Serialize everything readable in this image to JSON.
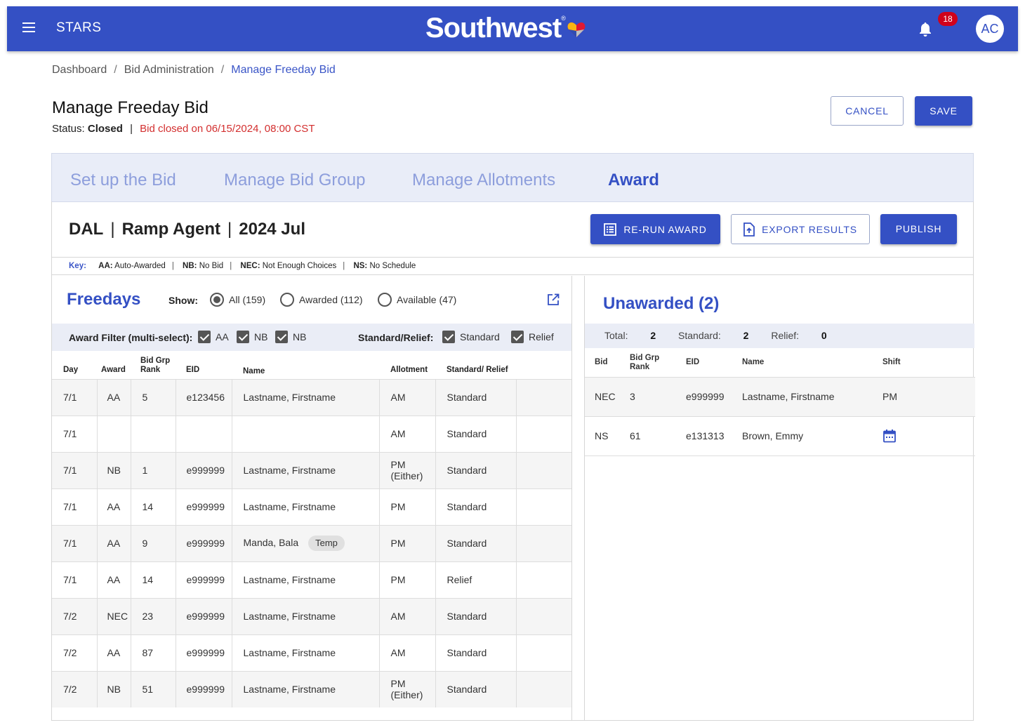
{
  "app": {
    "name": "STARS",
    "brand": "Southwest",
    "notifications": "18",
    "avatar_initials": "AC"
  },
  "breadcrumb": [
    "Dashboard",
    "Bid Administration",
    "Manage Freeday Bid"
  ],
  "page": {
    "title": "Manage Freeday Bid",
    "status_label": "Status:",
    "status_value": "Closed",
    "closed_text": "Bid closed on 06/15/2024, 08:00 CST",
    "cancel": "CANCEL",
    "save": "SAVE"
  },
  "tabs": [
    "Set up the Bid",
    "Manage Bid Group",
    "Manage Allotments",
    "Award"
  ],
  "active_tab": "Award",
  "context": {
    "station": "DAL",
    "role": "Ramp Agent",
    "period": "2024 Jul",
    "rerun": "RE-RUN AWARD",
    "export": "EXPORT RESULTS",
    "publish": "PUBLISH"
  },
  "key": {
    "label": "Key:",
    "items": [
      {
        "code": "AA:",
        "desc": "Auto-Awarded"
      },
      {
        "code": "NB:",
        "desc": "No Bid"
      },
      {
        "code": "NEC:",
        "desc": "Not Enough Choices"
      },
      {
        "code": "NS:",
        "desc": "No Schedule"
      }
    ]
  },
  "freedays": {
    "title": "Freedays",
    "show_label": "Show:",
    "show_options": [
      "All (159)",
      "Awarded (112)",
      "Available (47)"
    ],
    "show_selected": "All (159)",
    "award_filter_label": "Award Filter (multi-select):",
    "award_filters": [
      "AA",
      "NB",
      "NB"
    ],
    "sr_label": "Standard/Relief:",
    "sr_filters": [
      "Standard",
      "Relief"
    ],
    "columns": [
      "Day",
      "Award",
      "Bid Grp Rank",
      "EID",
      "Name",
      "Allotment",
      "Standard/ Relief"
    ],
    "rows": [
      {
        "day": "7/1",
        "award": "AA",
        "rank": "5",
        "eid": "e123456",
        "name": "Lastname, Firstname",
        "tag": "",
        "allot": "AM",
        "sr": "Standard"
      },
      {
        "day": "7/1",
        "award": "",
        "rank": "",
        "eid": "",
        "name": "",
        "tag": "",
        "allot": "AM",
        "sr": "Standard"
      },
      {
        "day": "7/1",
        "award": "NB",
        "rank": "1",
        "eid": "e999999",
        "name": "Lastname, Firstname",
        "tag": "",
        "allot": "PM (Either)",
        "sr": "Standard"
      },
      {
        "day": "7/1",
        "award": "AA",
        "rank": "14",
        "eid": "e999999",
        "name": "Lastname, Firstname",
        "tag": "",
        "allot": "PM",
        "sr": "Standard"
      },
      {
        "day": "7/1",
        "award": "AA",
        "rank": "9",
        "eid": "e999999",
        "name": "Manda, Bala",
        "tag": "Temp",
        "allot": "PM",
        "sr": "Standard"
      },
      {
        "day": "7/1",
        "award": "AA",
        "rank": "14",
        "eid": "e999999",
        "name": "Lastname, Firstname",
        "tag": "",
        "allot": "PM",
        "sr": "Relief"
      },
      {
        "day": "7/2",
        "award": "NEC",
        "rank": "23",
        "eid": "e999999",
        "name": "Lastname, Firstname",
        "tag": "",
        "allot": "AM",
        "sr": "Standard"
      },
      {
        "day": "7/2",
        "award": "AA",
        "rank": "87",
        "eid": "e999999",
        "name": "Lastname, Firstname",
        "tag": "",
        "allot": "AM",
        "sr": "Standard"
      },
      {
        "day": "7/2",
        "award": "NB",
        "rank": "51",
        "eid": "e999999",
        "name": "Lastname, Firstname",
        "tag": "",
        "allot": "PM (Either)",
        "sr": "Standard"
      }
    ]
  },
  "unawarded": {
    "title": "Unawarded (2)",
    "totals": [
      {
        "label": "Total:",
        "value": "2"
      },
      {
        "label": "Standard:",
        "value": "2"
      },
      {
        "label": "Relief:",
        "value": "0"
      }
    ],
    "columns": [
      "Bid",
      "Bid Grp Rank",
      "EID",
      "Name",
      "Shift"
    ],
    "rows": [
      {
        "bid": "NEC",
        "rank": "3",
        "eid": "e999999",
        "name": "Lastname, Firstname",
        "shift": "PM",
        "shift_icon": ""
      },
      {
        "bid": "NS",
        "rank": "61",
        "eid": "e131313",
        "name": "Brown, Emmy",
        "shift": "",
        "shift_icon": "calendar-icon"
      }
    ]
  },
  "colors": {
    "primary": "#3450c4",
    "tab_inactive": "#8d9edc",
    "error": "#d32f2f",
    "badge": "#d0021b"
  }
}
